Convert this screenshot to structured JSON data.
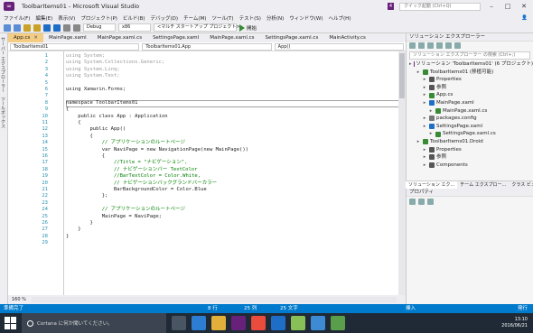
{
  "window": {
    "title": "ToolbarItems01 - Microsoft Visual Studio",
    "notification_count": "4",
    "quick_launch_placeholder": "クイック起動 (Ctrl+Q)"
  },
  "menu": [
    "ファイル(F)",
    "編集(E)",
    "表示(V)",
    "プロジェクト(P)",
    "ビルド(B)",
    "デバッグ(D)",
    "チーム(M)",
    "ツール(T)",
    "テスト(S)",
    "分析(N)",
    "ウィンドウ(W)",
    "ヘルプ(H)"
  ],
  "toolbar": {
    "config": "Debug",
    "platform": "x86",
    "startup_project": "<マルチ スタートアップ プロジェクト>",
    "start_label": "開始"
  },
  "left_strip": {
    "label_1": "サーバー エクスプローラー",
    "label_2": "ツールボックス"
  },
  "doc_tabs": [
    "App.cs",
    "MainPage.xaml",
    "MainPage.xaml.cs",
    "SettingsPage.xaml",
    "MainPage.xaml.cs",
    "SettingsPage.xaml.cs",
    "MainActivity.cs"
  ],
  "navbar": {
    "project": "ToolbarItems01",
    "class": "ToolbarItems01.App",
    "member": "App()"
  },
  "code_lines": [
    {
      "n": "1",
      "t": "using System;",
      "c": "gr"
    },
    {
      "n": "2",
      "t": "using System.Collections.Generic;",
      "c": "gr"
    },
    {
      "n": "3",
      "t": "using System.Linq;",
      "c": "gr"
    },
    {
      "n": "4",
      "t": "using System.Text;",
      "c": "gr"
    },
    {
      "n": "5",
      "t": "",
      "c": "nm"
    },
    {
      "n": "6",
      "t": "using Xamarin.Forms;",
      "c": "nm"
    },
    {
      "n": "7",
      "t": "",
      "c": "nm"
    },
    {
      "n": "8",
      "t": "namespace ToolbarItems01",
      "c": "nm"
    },
    {
      "n": "9",
      "t": "{",
      "c": "nm"
    },
    {
      "n": "10",
      "t": "    public class App : Application",
      "c": "nm"
    },
    {
      "n": "11",
      "t": "    {",
      "c": "nm"
    },
    {
      "n": "12",
      "t": "        public App()",
      "c": "nm"
    },
    {
      "n": "13",
      "t": "        {",
      "c": "nm"
    },
    {
      "n": "14",
      "t": "            // アプリケーションのルートページ",
      "c": "cm"
    },
    {
      "n": "15",
      "t": "            var NaviPage = new NavigationPage(new MainPage())",
      "c": "nm"
    },
    {
      "n": "16",
      "t": "            {",
      "c": "nm"
    },
    {
      "n": "17",
      "t": "                //Title = \"ナビゲーション\",",
      "c": "cm"
    },
    {
      "n": "18",
      "t": "                // ナビゲーションバー TextColor",
      "c": "cm"
    },
    {
      "n": "19",
      "t": "                //BarTextColor = Color.White,",
      "c": "cm"
    },
    {
      "n": "20",
      "t": "                // ナビゲーションバックグランドバーカラー",
      "c": "cm"
    },
    {
      "n": "21",
      "t": "                BarBackgroundColor = Color.Blue",
      "c": "nm"
    },
    {
      "n": "22",
      "t": "            };",
      "c": "nm"
    },
    {
      "n": "23",
      "t": "",
      "c": "nm"
    },
    {
      "n": "24",
      "t": "            // アプリケーションのルートページ",
      "c": "cm"
    },
    {
      "n": "25",
      "t": "            MainPage = NaviPage;",
      "c": "nm"
    },
    {
      "n": "26",
      "t": "        }",
      "c": "nm"
    },
    {
      "n": "27",
      "t": "    }",
      "c": "nm"
    },
    {
      "n": "28",
      "t": "}",
      "c": "nm"
    },
    {
      "n": "29",
      "t": "",
      "c": "nm"
    }
  ],
  "zoom": "160 %",
  "solution": {
    "title": "ソリューション エクスプローラー",
    "search_placeholder": "ソリューション エクスプローラー の検索 (Ctrl+;)",
    "items": [
      {
        "label": "ソリューション 'ToolbarItems01' (6 プロジェクト)",
        "indent": 0,
        "icon": "solution-icon",
        "color": "#68217a"
      },
      {
        "label": "ToolbarItems01 (移植可能)",
        "indent": 1,
        "icon": "csharp-project-icon",
        "color": "#388a34"
      },
      {
        "label": "Properties",
        "indent": 2,
        "icon": "wrench-icon",
        "color": "#555555"
      },
      {
        "label": "参照",
        "indent": 2,
        "icon": "references-icon",
        "color": "#555555"
      },
      {
        "label": "App.cs",
        "indent": 2,
        "icon": "csharp-file-icon",
        "color": "#388a34"
      },
      {
        "label": "MainPage.xaml",
        "indent": 2,
        "icon": "xaml-file-icon",
        "color": "#1e6ec8"
      },
      {
        "label": "MainPage.xaml.cs",
        "indent": 3,
        "icon": "csharp-file-icon",
        "color": "#388a34"
      },
      {
        "label": "packages.config",
        "indent": 2,
        "icon": "config-file-icon",
        "color": "#777777"
      },
      {
        "label": "SettingsPage.xaml",
        "indent": 2,
        "icon": "xaml-file-icon",
        "color": "#1e6ec8"
      },
      {
        "label": "SettingsPage.xaml.cs",
        "indent": 3,
        "icon": "csharp-file-icon",
        "color": "#388a34"
      },
      {
        "label": "ToolbarItems01.Droid",
        "indent": 1,
        "icon": "csharp-project-icon",
        "color": "#388a34"
      },
      {
        "label": "Properties",
        "indent": 2,
        "icon": "wrench-icon",
        "color": "#555555"
      },
      {
        "label": "参照",
        "indent": 2,
        "icon": "references-icon",
        "color": "#555555"
      },
      {
        "label": "Components",
        "indent": 2,
        "icon": "components-icon",
        "color": "#555555"
      }
    ],
    "tabs": [
      "ソリューション エク...",
      "チーム エクスプロー...",
      "クラス ビュー"
    ]
  },
  "properties": {
    "title": "プロパティ"
  },
  "status": {
    "left": "準備完了",
    "line": "8 行",
    "col": "25 列",
    "char": "25 文字",
    "mode": "挿入",
    "publish": "発行"
  },
  "taskbar": {
    "cortana": "Cortana に何か聞いてください。",
    "time": "13:10",
    "date": "2016/06/21"
  }
}
